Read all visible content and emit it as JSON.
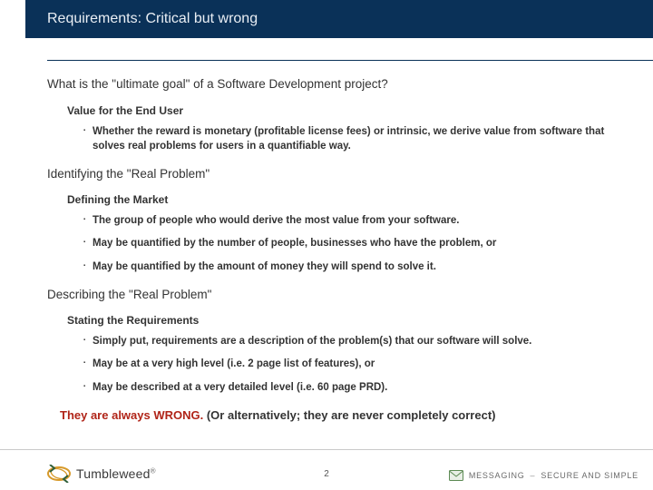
{
  "header": {
    "title": "Requirements: Critical but wrong"
  },
  "content": {
    "q1": "What is the \"ultimate goal\" of a Software Development project?",
    "sub1": "Value for the End User",
    "b1": [
      "Whether the reward is monetary (profitable license fees) or intrinsic, we derive value from software that solves real problems for users in a quantifiable way."
    ],
    "sec2": "Identifying the \"Real Problem\"",
    "sub2": "Defining the Market",
    "b2": [
      "The group of people who would derive the most value from your software.",
      "May be quantified by the number of people, businesses who have the problem, or",
      "May be quantified by the amount of money they will spend to solve it."
    ],
    "sec3": "Describing the \"Real Problem\"",
    "sub3": "Stating the Requirements",
    "b3": [
      "Simply put, requirements are a description of the problem(s) that our software will solve.",
      "May be at a very high level (i.e. 2 page list of features), or",
      "May be described at a very detailed level (i.e. 60 page PRD)."
    ],
    "callout_red": "They are always WRONG.",
    "callout_rest": " (Or alternatively; they are never completely correct)"
  },
  "footer": {
    "brand": "Tumbleweed",
    "page": "2",
    "tag_a": "MESSAGING",
    "tag_dash": "–",
    "tag_b": "SECURE AND SIMPLE"
  }
}
